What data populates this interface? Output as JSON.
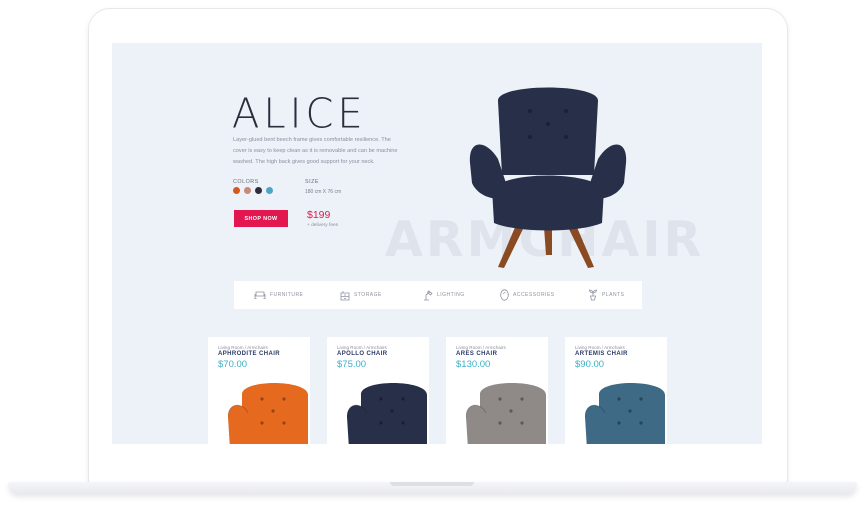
{
  "hero": {
    "title": "ALICE",
    "description": "Layer-glued bent beech frame gives comfortable resilience. The cover is easy to keep clean as it is removable and can be machine washed. The high back gives good support for your neck.",
    "colors_label": "COLORS",
    "colors": [
      "#d35a1c",
      "#c9887a",
      "#2b2e3a",
      "#4aa6c9"
    ],
    "size_label": "SIZE",
    "size_value": "180 cm X 76 cm",
    "button_label": "SHOP NOW",
    "price": "$199",
    "delivery_note": "+ delivery fees",
    "watermark": "ARMCHAIR",
    "chair_color": "#283049",
    "leg_color": "#8a4a22"
  },
  "categories": [
    {
      "label": "FURNITURE",
      "icon": "sofa-icon"
    },
    {
      "label": "STORAGE",
      "icon": "cabinet-icon"
    },
    {
      "label": "LIGHTING",
      "icon": "lamp-icon"
    },
    {
      "label": "ACCESSORIES",
      "icon": "mirror-icon"
    },
    {
      "label": "PLANTS",
      "icon": "plant-icon"
    }
  ],
  "products": [
    {
      "breadcrumb": "Living Room / Armchairs",
      "name": "APHRODITE CHAIR",
      "price": "$70.00",
      "color": "#e56a1f"
    },
    {
      "breadcrumb": "Living Room / Armchairs",
      "name": "APOLLO CHAIR",
      "price": "$75.00",
      "color": "#283049"
    },
    {
      "breadcrumb": "Living Room / Armchairs",
      "name": "ARES CHAIR",
      "price": "$130.00",
      "color": "#8f8a87"
    },
    {
      "breadcrumb": "Living Room / Armchairs",
      "name": "ARTEMIS CHAIR",
      "price": "$90.00",
      "color": "#3e6a86"
    }
  ],
  "theme": {
    "accent": "#e2174f",
    "price_color": "#3bb0c8",
    "name_color": "#2b3a67",
    "screen_bg": "#edf1f8"
  }
}
